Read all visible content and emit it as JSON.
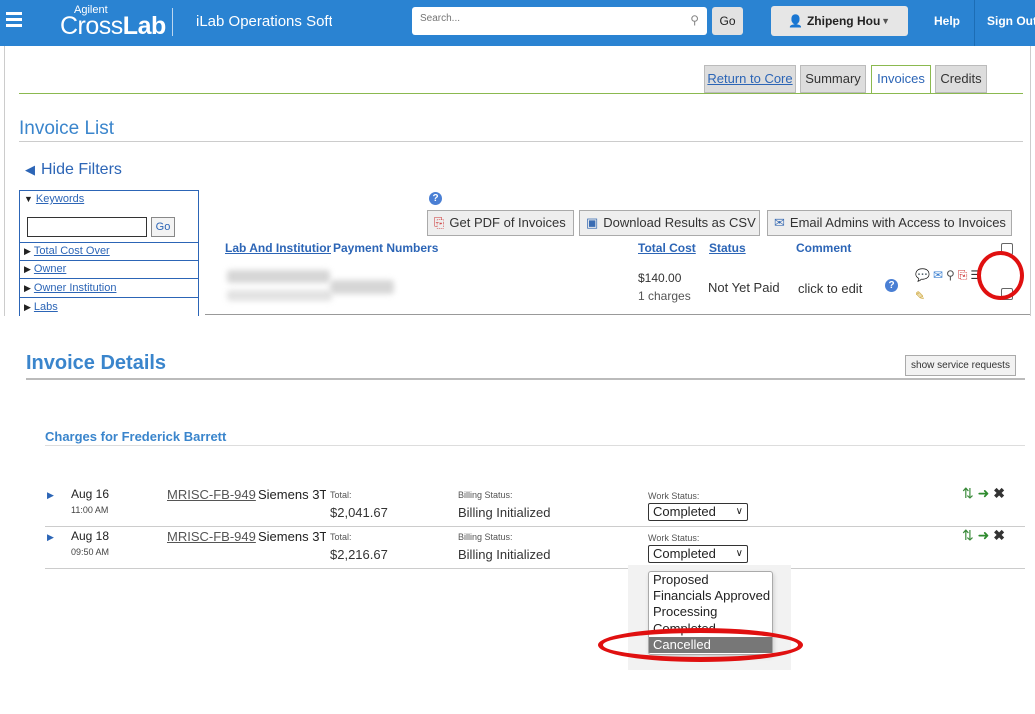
{
  "nav": {
    "logo_small": "Agilent",
    "logo_cross": "Cross",
    "logo_lab": "Lab",
    "app_title": "iLab Operations Software",
    "search_placeholder": "Search...",
    "go_label": "Go",
    "user_name": "Zhipeng Hou",
    "help_label": "Help",
    "signout_label": "Sign Out"
  },
  "tabs": [
    {
      "label": "Return to Core"
    },
    {
      "label": "Summary"
    },
    {
      "label": "Invoices"
    },
    {
      "label": "Credits"
    }
  ],
  "invoice_list": {
    "title": "Invoice List",
    "hide_filters": "Hide Filters",
    "filters": {
      "keywords": "Keywords",
      "go": "Go",
      "items": [
        "Total Cost Over",
        "Owner",
        "Owner Institution",
        "Labs"
      ]
    },
    "buttons": {
      "pdf": "Get PDF of Invoices",
      "csv": "Download Results as CSV",
      "email": "Email Admins with Access to Invoices"
    },
    "columns": {
      "lab": "Lab And Institution",
      "payment": "Payment Numbers",
      "total": "Total Cost",
      "status": "Status",
      "comment": "Comment"
    },
    "row": {
      "total": "$140.00",
      "charges": "1 charges",
      "status": "Not Yet Paid",
      "comment": "click to edit"
    }
  },
  "invoice_details": {
    "title": "Invoice Details",
    "show_service_requests": "show service requests",
    "charges_title": "Charges for Frederick Barrett",
    "rows": [
      {
        "date": "Aug 16",
        "time": "11:00 AM",
        "ref": "MRISC-FB-949",
        "service": "Siemens 3T",
        "total_label": "Total:",
        "total": "$2,041.67",
        "billing_label": "Billing Status:",
        "billing": "Billing Initialized",
        "work_label": "Work Status:",
        "work": "Completed"
      },
      {
        "date": "Aug 18",
        "time": "09:50 AM",
        "ref": "MRISC-FB-949",
        "service": "Siemens 3T",
        "total_label": "Total:",
        "total": "$2,216.67",
        "billing_label": "Billing Status:",
        "billing": "Billing Initialized",
        "work_label": "Work Status:",
        "work": "Completed"
      }
    ],
    "dropdown_options": [
      "Proposed",
      "Financials Approved",
      "Processing",
      "Completed",
      "Cancelled"
    ],
    "dropdown_selected": "Cancelled"
  },
  "colors": {
    "nav_blue": "#2a83d2",
    "heading_blue": "#3a85cc",
    "annotation_red": "#e01010",
    "tab_active_border": "#8bb94f"
  }
}
